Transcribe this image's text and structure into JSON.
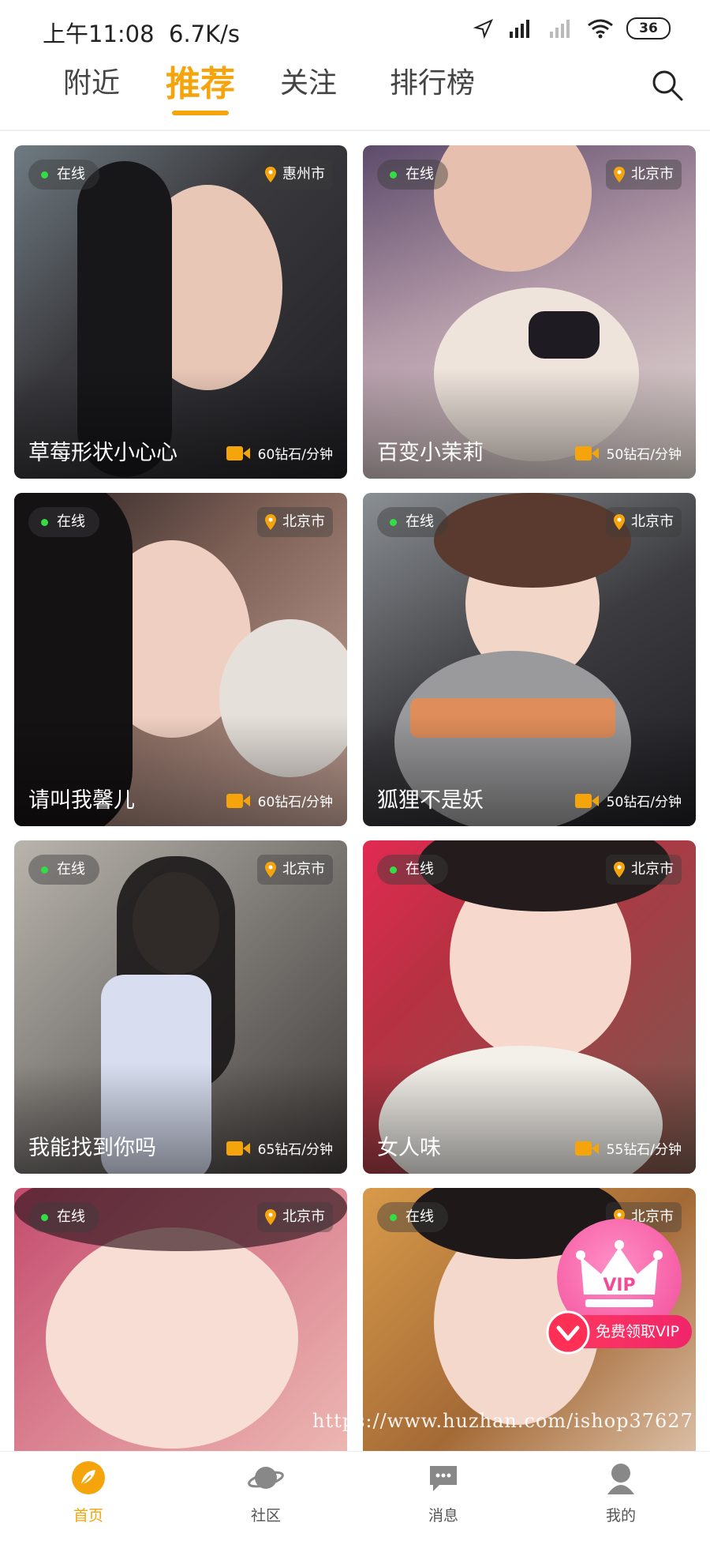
{
  "status_bar": {
    "time": "上午11:08",
    "speed": "6.7K/s",
    "battery": "36"
  },
  "tabs": [
    {
      "label": "附近"
    },
    {
      "label": "推荐",
      "active": true
    },
    {
      "label": "关注"
    },
    {
      "label": "排行榜"
    }
  ],
  "cards": [
    {
      "status": "在线",
      "city": "惠州市",
      "name": "草莓形状小心心",
      "price": "60钻石/分钟"
    },
    {
      "status": "在线",
      "city": "北京市",
      "name": "百变小茉莉",
      "price": "50钻石/分钟"
    },
    {
      "status": "在线",
      "city": "北京市",
      "name": "请叫我馨儿",
      "price": "60钻石/分钟"
    },
    {
      "status": "在线",
      "city": "北京市",
      "name": "狐狸不是妖",
      "price": "50钻石/分钟"
    },
    {
      "status": "在线",
      "city": "北京市",
      "name": "我能找到你吗",
      "price": "65钻石/分钟"
    },
    {
      "status": "在线",
      "city": "北京市",
      "name": "女人味",
      "price": "55钻石/分钟"
    },
    {
      "status": "在线",
      "city": "北京市"
    },
    {
      "status": "在线",
      "city": "北京市"
    }
  ],
  "vip": {
    "badge": "VIP",
    "label": "免费领取VIP"
  },
  "watermark": "https://www.huzhan.com/ishop37627",
  "bottom_nav": [
    {
      "label": "首页",
      "icon": "home-icon",
      "active": true
    },
    {
      "label": "社区",
      "icon": "planet-icon"
    },
    {
      "label": "消息",
      "icon": "message-icon"
    },
    {
      "label": "我的",
      "icon": "profile-icon"
    }
  ],
  "colors": {
    "accent": "#f5a40c",
    "online_dot": "#33dd44",
    "vip_pink": "#f24a97",
    "vip_banner": "#ff3a5e"
  }
}
